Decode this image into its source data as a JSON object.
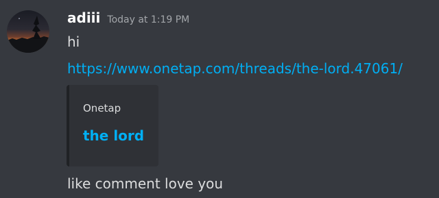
{
  "message": {
    "author": "adiii",
    "timestamp": "Today at 1:19 PM",
    "lines": {
      "greeting": "hi",
      "link": "https://www.onetap.com/threads/the-lord.47061/",
      "closing": "like comment love you"
    },
    "embed": {
      "provider": "Onetap",
      "title": "the lord"
    }
  },
  "colors": {
    "background": "#36393f",
    "link": "#00aff4",
    "embed_background": "#2f3136",
    "embed_border": "#202225",
    "username": "#ffffff",
    "timestamp": "#a3a6aa",
    "text": "#dcddde"
  },
  "icons": {
    "avatar": "user-avatar-sunset"
  }
}
